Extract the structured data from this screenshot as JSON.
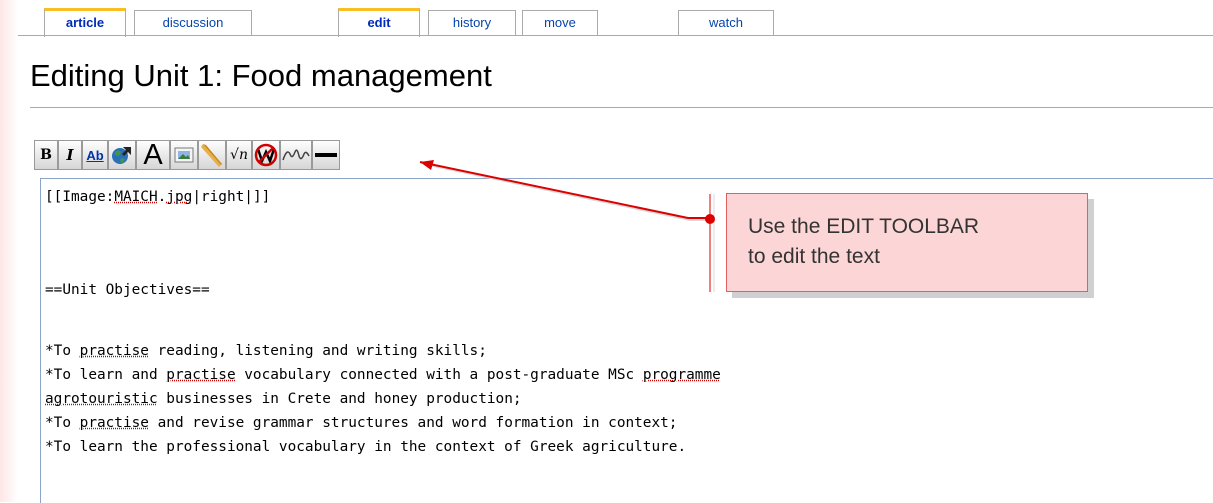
{
  "tabs": [
    {
      "label": "article",
      "selected": true
    },
    {
      "label": "discussion",
      "selected": false
    },
    {
      "label": "edit",
      "selected": true
    },
    {
      "label": "history",
      "selected": false
    },
    {
      "label": "move",
      "selected": false
    },
    {
      "label": "watch",
      "selected": false
    }
  ],
  "page": {
    "title": "Editing Unit 1: Food management"
  },
  "toolbar": {
    "bold_label": "B",
    "italic_label": "I",
    "link_label": "Ab",
    "headline_label": "A",
    "math_label": "√n",
    "icons": [
      "bold-icon",
      "italic-icon",
      "internal-link-icon",
      "external-link-icon",
      "headline-icon",
      "image-icon",
      "media-icon",
      "math-icon",
      "nowiki-icon",
      "signature-icon",
      "horizontal-line-icon"
    ]
  },
  "editor": {
    "line1": {
      "pre": "[[Image:",
      "sp1": "MAICH",
      "mid": ".",
      "sp2": "jpg",
      "post": "|right|]]"
    },
    "line2": "==Unit Objectives==",
    "line3": {
      "pre": "*To ",
      "sp1": "practise",
      "post": " reading, listening and writing skills;"
    },
    "line4": {
      "pre": "*To learn and ",
      "sp1": "practise",
      "mid": " vocabulary connected with a post-graduate MSc ",
      "sp2": "programme"
    },
    "line5": {
      "sp1": "agrotouristic",
      "post": " businesses in Crete and honey production;"
    },
    "line6": {
      "pre": "*To ",
      "sp1": "practise",
      "post": " and revise grammar structures and word formation in context;"
    },
    "line7": "*To learn the professional vocabulary in the context of Greek agriculture."
  },
  "callout": {
    "line1": "Use the EDIT TOOLBAR",
    "line2": "to edit the text"
  },
  "colors": {
    "link": "#0645ad",
    "tab_accent": "#fabd23",
    "callout_bg": "#fcd6d6",
    "arrow": "#dd0000"
  }
}
